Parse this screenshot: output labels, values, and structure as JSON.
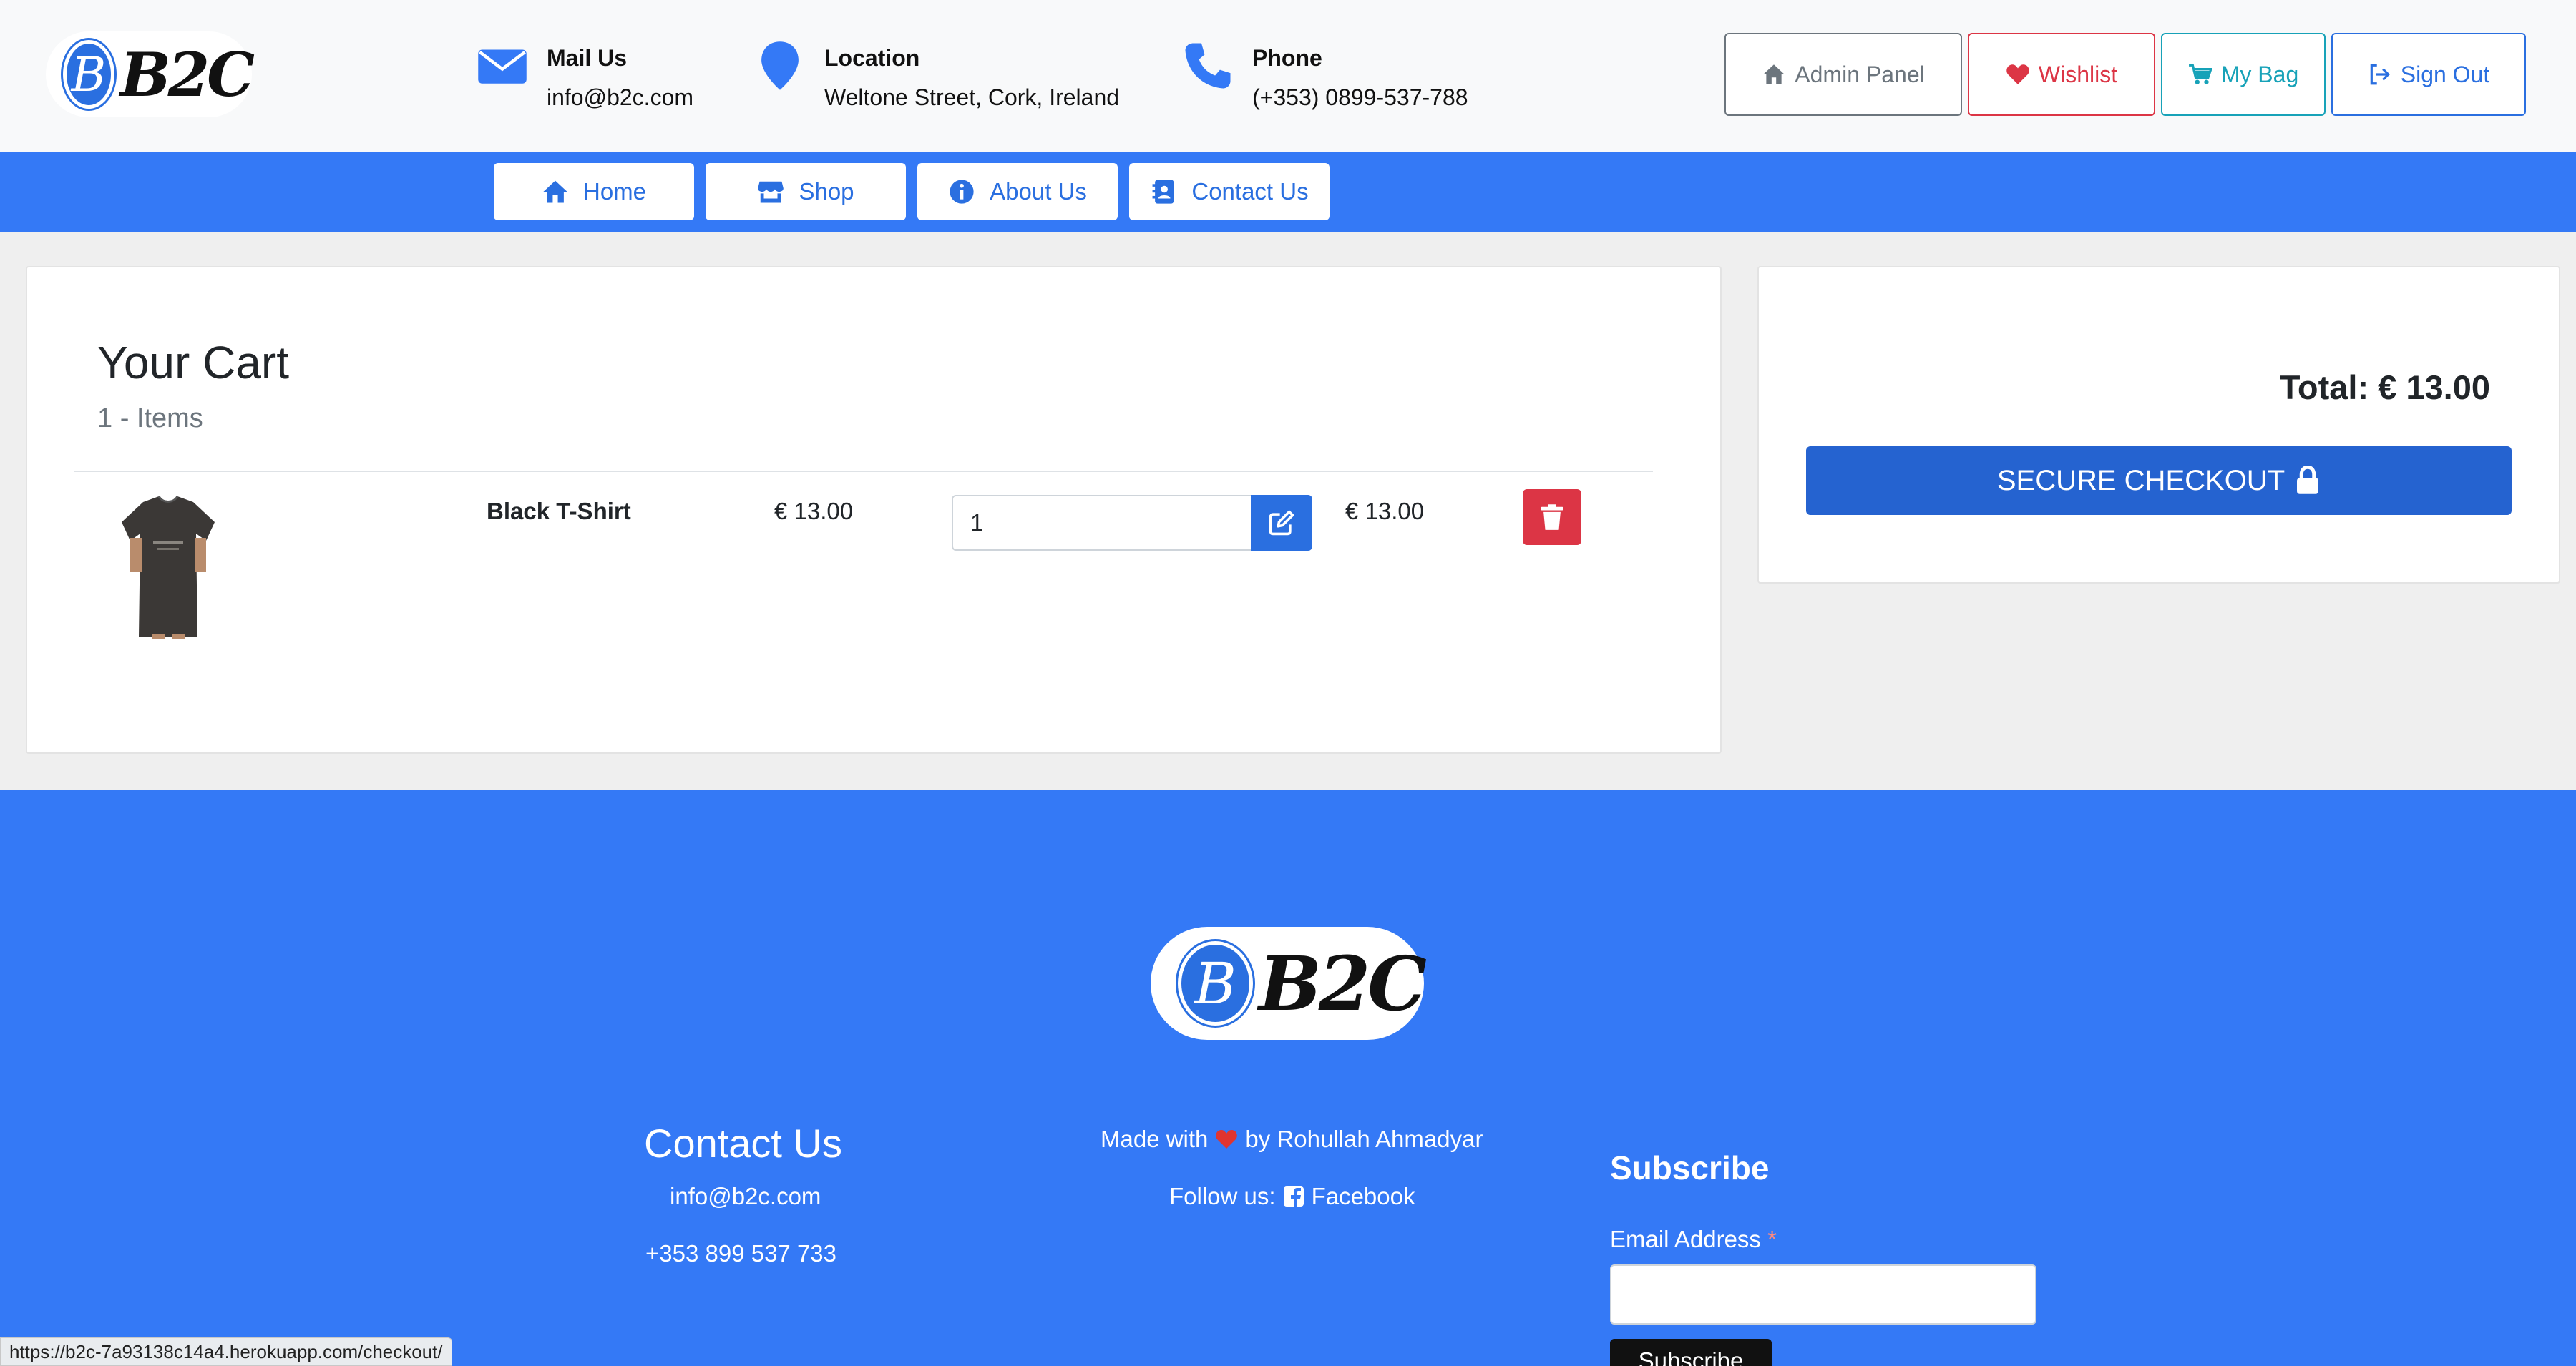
{
  "brand": {
    "logo_text": "B2C",
    "logo_letter": "B"
  },
  "header": {
    "mail": {
      "label": "Mail Us",
      "value": "info@b2c.com",
      "icon": "envelope-icon"
    },
    "location": {
      "label": "Location",
      "value": "Weltone Street, Cork, Ireland",
      "icon": "map-pin-icon"
    },
    "phone": {
      "label": "Phone",
      "value": "(+353) 0899-537-788",
      "icon": "phone-icon"
    },
    "buttons": {
      "admin": "Admin Panel",
      "wishlist": "Wishlist",
      "bag": "My Bag",
      "signout": "Sign Out"
    }
  },
  "nav": {
    "home": "Home",
    "shop": "Shop",
    "about": "About Us",
    "contact": "Contact Us"
  },
  "cart": {
    "title": "Your Cart",
    "count": "1 - Items",
    "items": [
      {
        "name": "Black T-Shirt",
        "price": "€ 13.00",
        "quantity": "1",
        "line_total": "€ 13.00"
      }
    ]
  },
  "summary": {
    "total": "Total: € 13.00",
    "checkout": "SECURE CHECKOUT"
  },
  "footer": {
    "contact_title": "Contact Us",
    "contact_email": "info@b2c.com",
    "contact_phone": "+353 899 537 733",
    "made_with_prefix": "Made with",
    "made_with_suffix": "by Rohullah Ahmadyar",
    "follow_prefix": "Follow us:",
    "follow_link": "Facebook",
    "subscribe_title": "Subscribe",
    "email_label": "Email Address",
    "required_mark": "*",
    "subscribe_button": "Subscribe"
  },
  "status_bar": {
    "url": "https://b2c-7a93138c14a4.herokuapp.com/checkout/"
  },
  "colors": {
    "primary": "#3479f6",
    "danger": "#dc3545",
    "info": "#17a2b8",
    "secondary": "#6c757d"
  }
}
